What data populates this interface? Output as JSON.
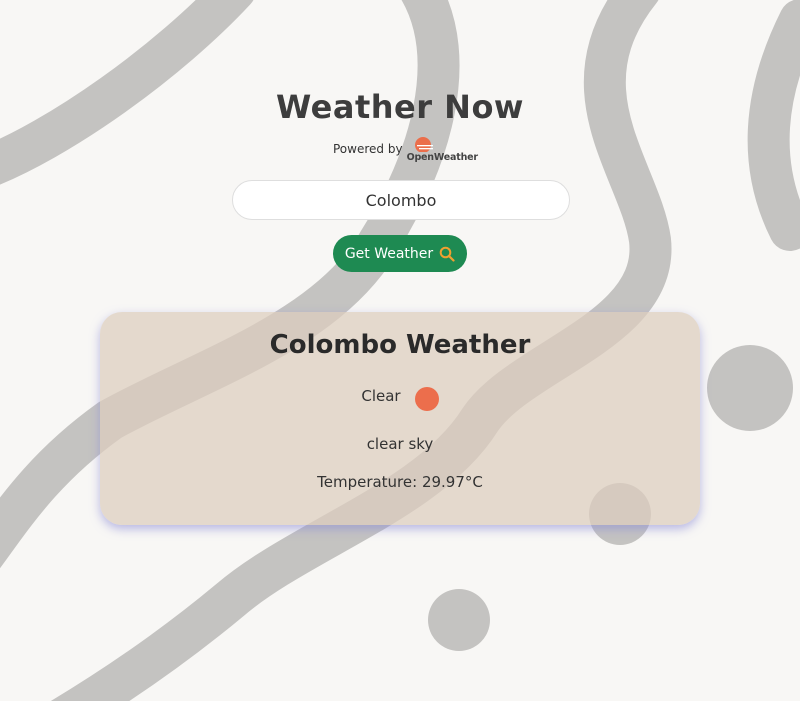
{
  "app": {
    "title": "Weather Now",
    "powered_by": "Powered by",
    "provider_name": "OpenWeather"
  },
  "search": {
    "value": "Colombo",
    "button_label": "Get Weather",
    "button_icon": "search-icon"
  },
  "result": {
    "title": "Colombo Weather",
    "condition": "Clear",
    "condition_icon": "clear-sun-icon",
    "description": "clear sky",
    "temperature": "Temperature: 29.97°C"
  },
  "colors": {
    "background": "#f8f7f5",
    "decor": "#c4c3c1",
    "button": "#1e8a52",
    "button_icon": "#f0a030",
    "sun_icon": "#ec6e4c",
    "card": "#dccdbe"
  }
}
